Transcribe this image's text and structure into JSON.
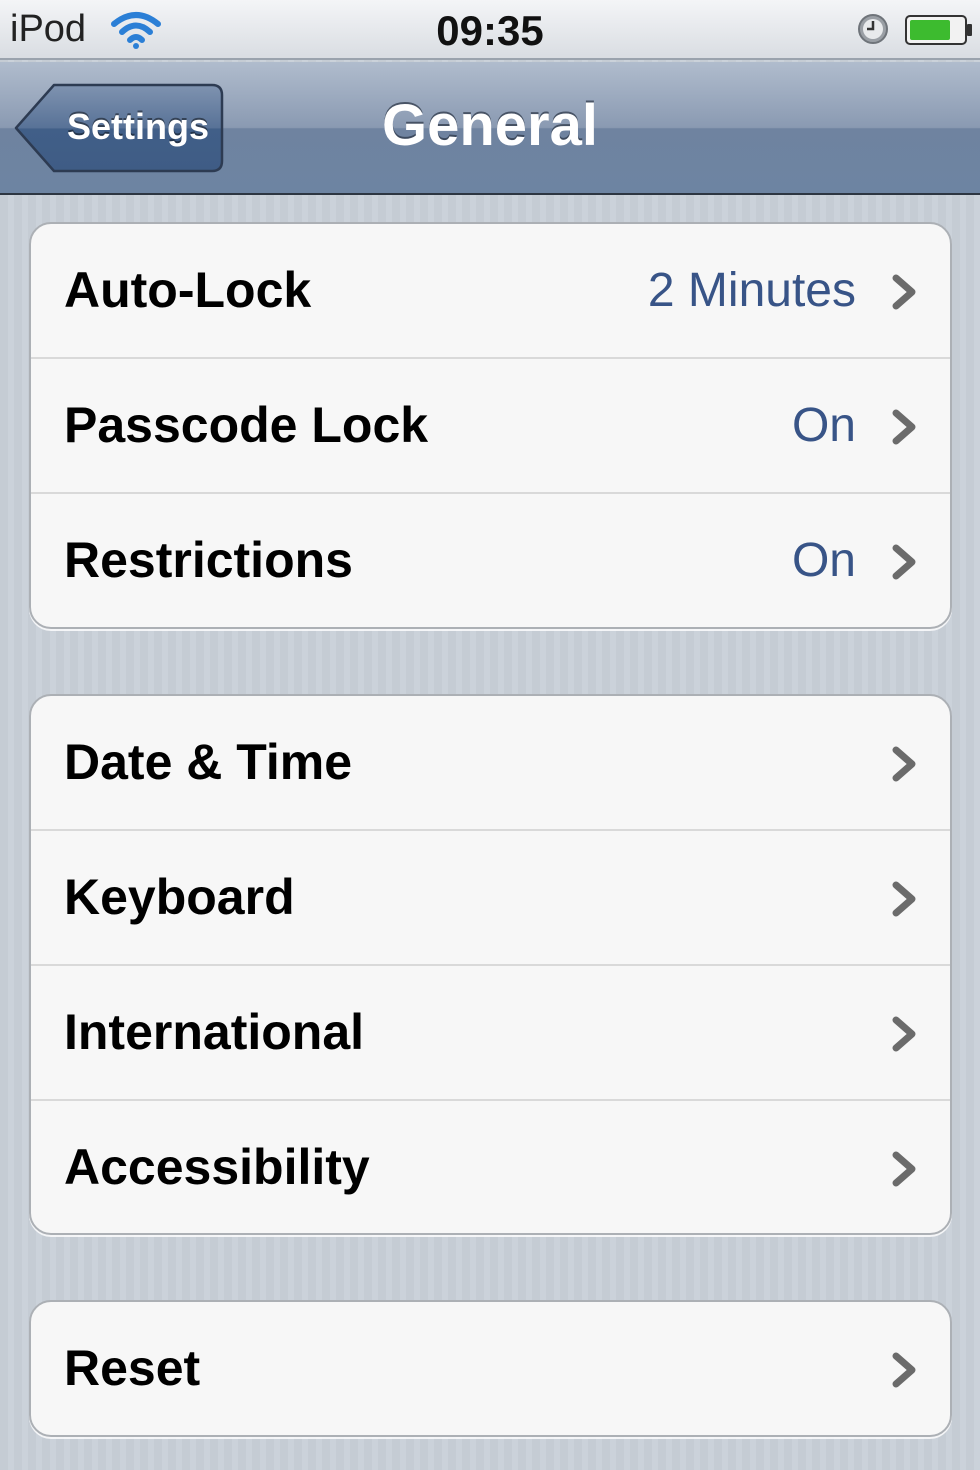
{
  "status_bar": {
    "carrier": "iPod",
    "time": "09:35"
  },
  "nav_bar": {
    "back_label": "Settings",
    "title": "General"
  },
  "groups": [
    {
      "rows": [
        {
          "label": "Auto-Lock",
          "value": "2 Minutes"
        },
        {
          "label": "Passcode Lock",
          "value": "On"
        },
        {
          "label": "Restrictions",
          "value": "On"
        }
      ]
    },
    {
      "rows": [
        {
          "label": "Date & Time"
        },
        {
          "label": "Keyboard"
        },
        {
          "label": "International"
        },
        {
          "label": "Accessibility"
        }
      ]
    },
    {
      "rows": [
        {
          "label": "Reset"
        }
      ]
    }
  ],
  "colors": {
    "value_text": "#385487",
    "nav_bar": "#6d84a2",
    "background": "#c5ccd4"
  },
  "icons": [
    "wifi-icon",
    "alarm-icon",
    "battery-icon",
    "back-arrow-icon",
    "chevron-right-icon"
  ]
}
